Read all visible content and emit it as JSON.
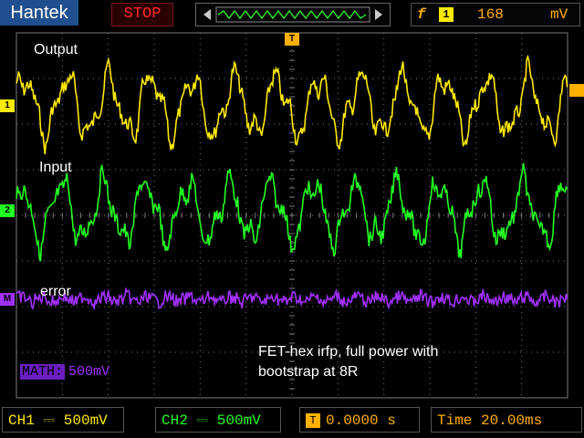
{
  "header": {
    "brand": "Hantek",
    "run_state": "STOP",
    "trigger_mode_icon": "f",
    "trigger_channel": "1",
    "trigger_level": "168",
    "trigger_unit": "mV",
    "memory_marker": "T"
  },
  "screen": {
    "trace_labels": {
      "output": "Output",
      "input": "Input",
      "error": "error"
    },
    "annotation_lines": [
      "FET-hex irfp, full power with",
      "bootstrap at 8R"
    ],
    "math_tag": "MATH:",
    "math_scale": "500mV",
    "markers": {
      "ch1": "1",
      "ch2": "2",
      "math": "M",
      "trigger_pos": "T"
    }
  },
  "status_bar": {
    "ch1": "CH1 ⎓ 500mV",
    "ch2": "CH2 ⎓ 500mV",
    "trigger_icon": "T",
    "trigger_time": "0.0000 s",
    "timebase": "Time 20.00ms"
  },
  "colors": {
    "ch1": "#ffea00",
    "ch2": "#22ff22",
    "math": "#a030ff",
    "trigger": "#ffb000",
    "grid": "#7a7a7a"
  }
}
